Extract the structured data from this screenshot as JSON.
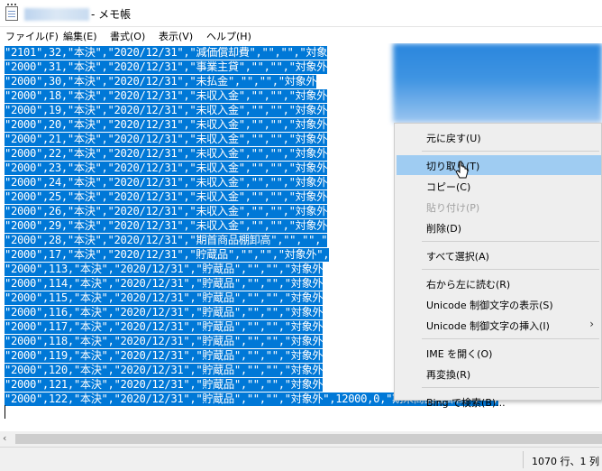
{
  "window": {
    "title": "- メモ帳"
  },
  "menubar": [
    {
      "label": "ファイル(F)",
      "key": "file"
    },
    {
      "label": "編集(E)",
      "key": "edit"
    },
    {
      "label": "書式(O)",
      "key": "format"
    },
    {
      "label": "表示(V)",
      "key": "view"
    },
    {
      "label": "ヘルプ(H)",
      "key": "help"
    }
  ],
  "editor": {
    "lines": [
      {
        "text": "\"2101\",32,\"本決\",\"2020/12/31\",\"減価償却費\",\"\",\"\",\"対象"
      },
      {
        "text": "\"2000\",31,\"本決\",\"2020/12/31\",\"事業主貸\",\"\",\"\",\"対象外"
      },
      {
        "text": "\"2000\",30,\"本決\",\"2020/12/31\",\"未払金\",\"\",\"\",\"対象外"
      },
      {
        "text": "\"2000\",18,\"本決\",\"2020/12/31\",\"未収入金\",\"\",\"\",\"対象外"
      },
      {
        "text": "\"2000\",19,\"本決\",\"2020/12/31\",\"未収入金\",\"\",\"\",\"対象外"
      },
      {
        "text": "\"2000\",20,\"本決\",\"2020/12/31\",\"未収入金\",\"\",\"\",\"対象外"
      },
      {
        "text": "\"2000\",21,\"本決\",\"2020/12/31\",\"未収入金\",\"\",\"\",\"対象外"
      },
      {
        "text": "\"2000\",22,\"本決\",\"2020/12/31\",\"未収入金\",\"\",\"\",\"対象外"
      },
      {
        "text": "\"2000\",23,\"本決\",\"2020/12/31\",\"未収入金\",\"\",\"\",\"対象外"
      },
      {
        "text": "\"2000\",24,\"本決\",\"2020/12/31\",\"未収入金\",\"\",\"\",\"対象外"
      },
      {
        "text": "\"2000\",25,\"本決\",\"2020/12/31\",\"未収入金\",\"\",\"\",\"対象外"
      },
      {
        "text": "\"2000\",26,\"本決\",\"2020/12/31\",\"未収入金\",\"\",\"\",\"対象外"
      },
      {
        "text": "\"2000\",29,\"本決\",\"2020/12/31\",\"未収入金\",\"\",\"\",\"対象外"
      },
      {
        "text": "\"2000\",28,\"本決\",\"2020/12/31\",\"期首商品棚卸高\",\"\",\"\",\""
      },
      {
        "text": "\"2000\",17,\"本決\",\"2020/12/31\",\"貯蔵品\",\"\",\"\",\"対象外\","
      },
      {
        "text": "\"2000\",113,\"本決\",\"2020/12/31\",\"貯蔵品\",\"\",\"\",\"対象外"
      },
      {
        "text": "\"2000\",114,\"本決\",\"2020/12/31\",\"貯蔵品\",\"\",\"\",\"対象外"
      },
      {
        "text": "\"2000\",115,\"本決\",\"2020/12/31\",\"貯蔵品\",\"\",\"\",\"対象外"
      },
      {
        "text": "\"2000\",116,\"本決\",\"2020/12/31\",\"貯蔵品\",\"\",\"\",\"対象外"
      },
      {
        "text": "\"2000\",117,\"本決\",\"2020/12/31\",\"貯蔵品\",\"\",\"\",\"対象外"
      },
      {
        "text": "\"2000\",118,\"本決\",\"2020/12/31\",\"貯蔵品\",\"\",\"\",\"対象外"
      },
      {
        "text": "\"2000\",119,\"本決\",\"2020/12/31\",\"貯蔵品\",\"\",\"\",\"対象外"
      },
      {
        "text": "\"2000\",120,\"本決\",\"2020/12/31\",\"貯蔵品\",\"\",\"\",\"対象外"
      },
      {
        "text": "\"2000\",121,\"本決\",\"2020/12/31\",\"貯蔵品\",\"\",\"\",\"対象外"
      },
      {
        "text": "\"2000\",122,\"本決\",\"2020/12/31\",\"貯蔵品\",\"\",\"\",\"対象外\",12000,0,\"期末商品棚卸高\",\"\","
      }
    ]
  },
  "statusbar": {
    "position": "1070 行、1 列"
  },
  "context_menu": {
    "items": [
      {
        "label": "元に戻す(U)",
        "name": "undo",
        "enabled": true
      },
      {
        "sep": true
      },
      {
        "label": "切り取り(T)",
        "name": "cut",
        "enabled": true,
        "hover": true
      },
      {
        "label": "コピー(C)",
        "name": "copy",
        "enabled": true
      },
      {
        "label": "貼り付け(P)",
        "name": "paste",
        "enabled": false
      },
      {
        "label": "削除(D)",
        "name": "delete",
        "enabled": true
      },
      {
        "sep": true
      },
      {
        "label": "すべて選択(A)",
        "name": "select-all",
        "enabled": true
      },
      {
        "sep": true
      },
      {
        "label": "右から左に読む(R)",
        "name": "rtl-reading",
        "enabled": true
      },
      {
        "label": "Unicode 制御文字の表示(S)",
        "name": "show-unicode-control",
        "enabled": true
      },
      {
        "label": "Unicode 制御文字の挿入(I)",
        "name": "insert-unicode-control",
        "enabled": true,
        "submenu": true
      },
      {
        "sep": true
      },
      {
        "label": "IME を開く(O)",
        "name": "open-ime",
        "enabled": true
      },
      {
        "label": "再変換(R)",
        "name": "reconversion",
        "enabled": true
      },
      {
        "sep": true
      },
      {
        "label": "Bing で検索(B)...",
        "name": "bing-search",
        "enabled": true
      }
    ]
  },
  "icons": {
    "app": "notepad-icon",
    "scroll_left": "scroll-left-arrow-icon",
    "pointer": "mouse-pointer-icon",
    "submenu": "submenu-arrow-icon"
  },
  "colors": {
    "selection": "#0078d7",
    "menu_hover": "#9fccf2",
    "menu_bg": "#eeeeee"
  }
}
